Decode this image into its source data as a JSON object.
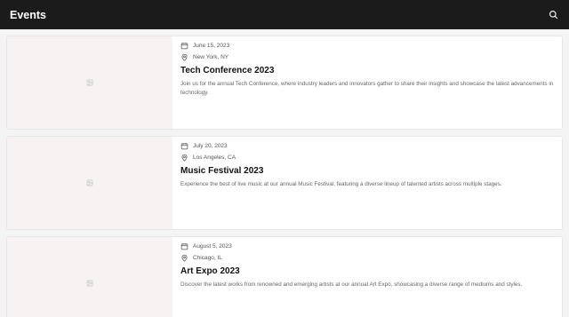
{
  "header": {
    "title": "Events",
    "search_icon": "search-icon"
  },
  "events": [
    {
      "date": "June 15, 2023",
      "location": "New York, NY",
      "title": "Tech Conference 2023",
      "description": "Join us for the annual Tech Conference, where industry leaders and innovators gather to share their insights and showcase the latest advancements in technology.",
      "image_icon": "image-placeholder-icon"
    },
    {
      "date": "July 20, 2023",
      "location": "Los Angeles, CA",
      "title": "Music Festival 2023",
      "description": "Experience the best of live music at our annual Music Festival, featuring a diverse lineup of talented artists across multiple stages.",
      "image_icon": "image-placeholder-icon"
    },
    {
      "date": "August 5, 2023",
      "location": "Chicago, IL",
      "title": "Art Expo 2023",
      "description": "Discover the latest works from renowned and emerging artists at our annual Art Expo, showcasing a diverse range of mediums and styles.",
      "image_icon": "image-placeholder-icon"
    }
  ],
  "colors": {
    "header_bg": "#1b1b1b",
    "page_bg": "#f4f4f5",
    "thumb_bg": "#f6f3f2"
  }
}
